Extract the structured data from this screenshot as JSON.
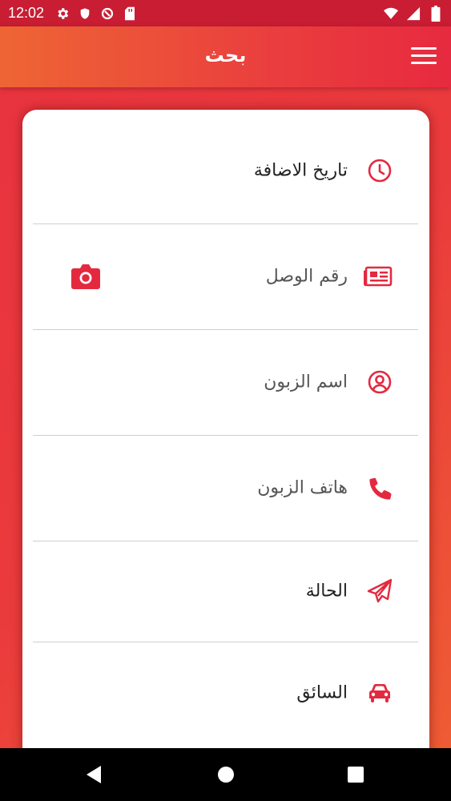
{
  "status_bar": {
    "time": "12:02",
    "left_icons": [
      "gear-icon",
      "shield-icon",
      "data-saver-icon",
      "sd-card-icon"
    ],
    "right_icons": [
      "wifi-icon",
      "signal-icon",
      "battery-icon"
    ]
  },
  "app_bar": {
    "title": "بحث",
    "menu_icon": "hamburger-menu-icon"
  },
  "search_fields": [
    {
      "label": "تاريخ الاضافة",
      "icon": "clock-icon"
    },
    {
      "label": "رقم الوصل",
      "icon": "receipt-card-icon",
      "action_icon": "camera-icon"
    },
    {
      "label": "اسم الزبون",
      "icon": "user-circle-icon"
    },
    {
      "label": "هاتف الزبون",
      "icon": "phone-icon"
    },
    {
      "label": "الحالة",
      "icon": "paper-plane-icon"
    },
    {
      "label": "السائق",
      "icon": "car-icon"
    }
  ],
  "nav_bar": {
    "buttons": [
      "back-icon",
      "home-icon",
      "recents-icon"
    ]
  },
  "colors": {
    "accent": "#e4293f",
    "gradient_start": "#ee6534",
    "gradient_end": "#e72a3f"
  }
}
